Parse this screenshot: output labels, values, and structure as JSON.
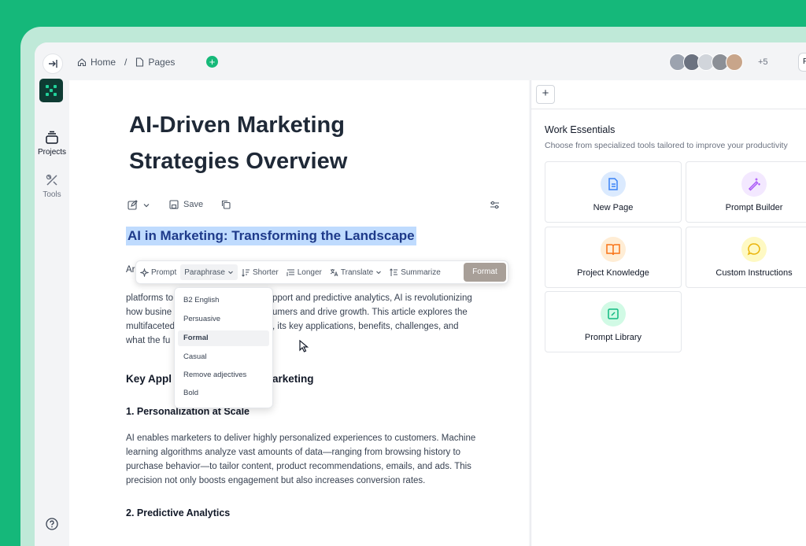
{
  "topbar": {
    "breadcrumb_home": "Home",
    "breadcrumb_sep": "/",
    "breadcrumb_pages": "Pages",
    "add_symbol": "+",
    "more_count": "+5",
    "feedback_label": "Feedback"
  },
  "sidebar": {
    "projects_label": "Projects",
    "tools_label": "Tools"
  },
  "document": {
    "title": "AI-Driven Marketing Strategies Overview",
    "save_label": "Save",
    "heading": "AI in Marketing: Transforming the Landscape",
    "intro_lines": [
      "Ar",
      "platforms to",
      "how busine",
      "multifaceted",
      "what the fu"
    ],
    "intro_right_lines": [
      "pport and predictive analytics, AI is revolutionizing",
      "umers and drive growth. This article explores the",
      ", its key applications, benefits, challenges, and"
    ],
    "section_heading_left": "Key Appl",
    "section_heading_right": "arketing",
    "sub1": "1. Personalization at Scale",
    "para1": "AI enables marketers to deliver highly personalized experiences to customers. Machine learning algorithms analyze vast amounts of data—ranging from browsing history to purchase behavior—to tailor content, product recommendations, emails, and ads. This precision not only boosts engagement but also increases conversion rates.",
    "sub2": "2. Predictive Analytics"
  },
  "format_toolbar": {
    "prompt": "Prompt",
    "paraphrase": "Paraphrase",
    "shorter": "Shorter",
    "longer": "Longer",
    "translate": "Translate",
    "summarize": "Summarize",
    "format": "Format"
  },
  "paraphrase_menu": {
    "options": [
      "B2 English",
      "Persuasive",
      "Formal",
      "Casual",
      "Remove adjectives",
      "Bold"
    ],
    "active": "Formal"
  },
  "right_panel": {
    "add_symbol": "+",
    "title": "Work Essentials",
    "subtitle": "Choose from specialized tools tailored to improve your productivity",
    "cards": [
      {
        "label": "New Page",
        "icon": "document-icon",
        "color": "#3b82f6"
      },
      {
        "label": "Prompt Builder",
        "icon": "magic-wand-icon",
        "color": "#a855f7"
      },
      {
        "label": "Project Knowledge",
        "icon": "book-icon",
        "color": "#f97316"
      },
      {
        "label": "Custom Instructions",
        "icon": "chat-bubble-icon",
        "color": "#eab308"
      },
      {
        "label": "Prompt Library",
        "icon": "edit-square-icon",
        "color": "#10b981"
      }
    ]
  },
  "colors": {
    "brand_green": "#15b87a",
    "highlight": "#bfdbfe",
    "format_button": "#a89f98"
  }
}
